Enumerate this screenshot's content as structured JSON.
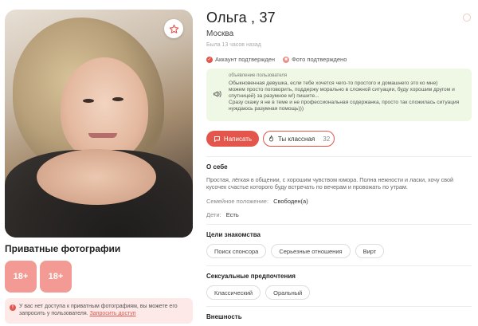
{
  "profile": {
    "name_age": "Ольга , 37",
    "city": "Москва",
    "last_seen": "Была 13 часов назад",
    "badges": [
      {
        "label": "Аккаунт подтвержден",
        "icon": "check-icon"
      },
      {
        "label": "Фото подтверждено",
        "icon": "camera-icon"
      }
    ]
  },
  "ad": {
    "title": "объявление пользователя",
    "text": "Обыкновенная девушка, если тебе хочется чего-то простого и домашнего это ко мне)\nможем просто поговорить, поддержу морально в сложной ситуации, буду хорошим другом и спутницей) за разумное м!) пишите...\nСразу скажу я не в теме и не профессиональная содержанка, просто так сложилась ситуация нуждаюсь разумная помощь)))"
  },
  "actions": {
    "write_label": "Написать",
    "like_label": "Ты классная",
    "like_count": "32"
  },
  "about": {
    "title": "О себе",
    "text": "Простая, лёгкая в общении, с хорошим чувством юмора. Полна нежности и ласки, хочу свой кусочек счастье которого буду встречать по вечерам и провожать по утрам.",
    "marital_label": "Семейное положение:",
    "marital_value": "Свободен(а)",
    "kids_label": "Дети:",
    "kids_value": "Есть"
  },
  "goals": {
    "title": "Цели знакомства",
    "items": [
      "Поиск спонсора",
      "Серьезные отношения",
      "Вирт"
    ]
  },
  "sexual": {
    "title": "Сексуальные предпочтения",
    "items": [
      "Классический",
      "Оральный"
    ]
  },
  "appearance": {
    "title": "Внешность"
  },
  "private": {
    "title": "Приватные фотографии",
    "tiles": [
      "18+",
      "18+"
    ],
    "note": "У вас нет доступа к приватным фотографиям, вы можете его запросить у пользователя.",
    "link": "Запросить доступ"
  },
  "colors": {
    "accent": "#e4554b",
    "ad_bg": "#eef8e4",
    "private_tile": "#f29a93"
  }
}
